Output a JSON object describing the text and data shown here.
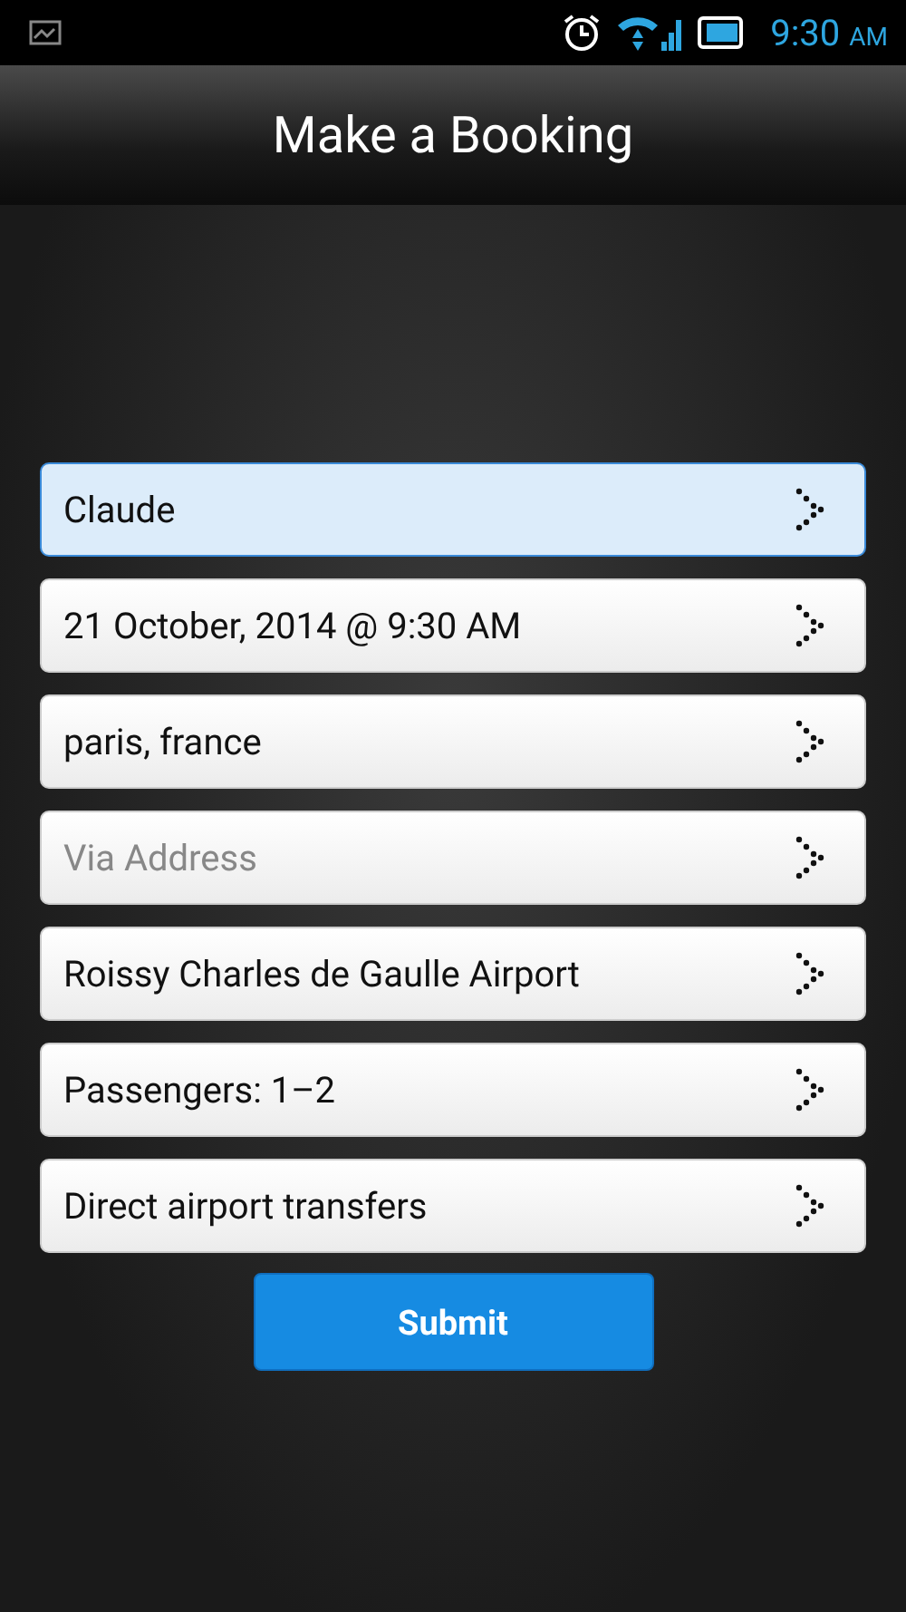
{
  "status_bar": {
    "time": "9:30",
    "ampm": "AM"
  },
  "title": "Make a Booking",
  "fields": [
    {
      "value": "Claude",
      "selected": true
    },
    {
      "value": "21 October, 2014 @ 9:30 AM",
      "selected": false
    },
    {
      "value": "paris, france",
      "selected": false
    },
    {
      "placeholder": "Via Address",
      "selected": false
    },
    {
      "value": "Roissy Charles de Gaulle Airport",
      "selected": false
    },
    {
      "value": "Passengers: 1–2",
      "selected": false
    },
    {
      "value": "Direct airport transfers",
      "selected": false
    }
  ],
  "submit": "Submit"
}
